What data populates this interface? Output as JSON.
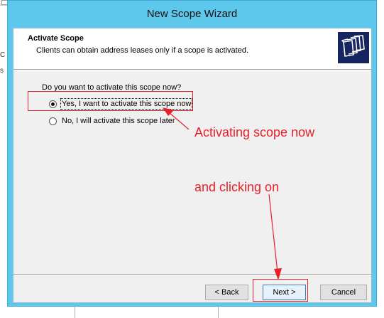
{
  "window": {
    "title": "New Scope Wizard"
  },
  "header": {
    "title": "Activate Scope",
    "subtitle": "Clients can obtain address leases only if a scope is activated.",
    "icon": "folder-stack-icon"
  },
  "body": {
    "question": "Do you want to activate this scope now?",
    "options": [
      {
        "label": "Yes, I want to activate this scope now",
        "selected": true
      },
      {
        "label": "No, I will activate this scope later",
        "selected": false
      }
    ]
  },
  "buttons": {
    "back": "< Back",
    "next": "Next >",
    "cancel": "Cancel"
  },
  "annotations": {
    "activating": "Activating scope now",
    "clicking": "and clicking on",
    "color": "#e8202a"
  },
  "background": {
    "left_glyphs": [
      "C",
      "s"
    ]
  }
}
